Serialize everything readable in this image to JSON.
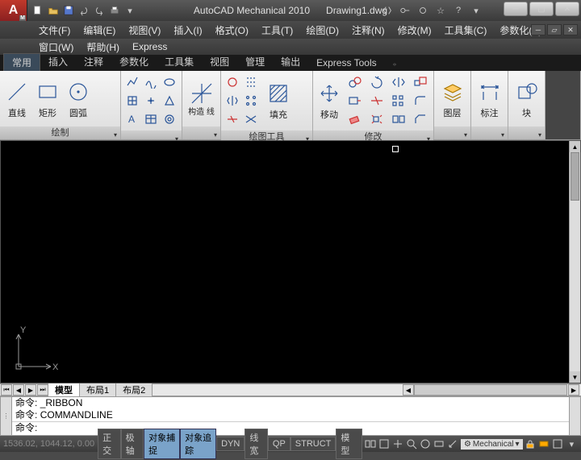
{
  "title": {
    "app": "AutoCAD Mechanical 2010",
    "doc": "Drawing1.dwg"
  },
  "menus1": [
    {
      "id": "file",
      "label": "文件(F)"
    },
    {
      "id": "edit",
      "label": "编辑(E)"
    },
    {
      "id": "view",
      "label": "视图(V)"
    },
    {
      "id": "insert",
      "label": "插入(I)"
    },
    {
      "id": "format",
      "label": "格式(O)"
    },
    {
      "id": "tools",
      "label": "工具(T)"
    },
    {
      "id": "draw",
      "label": "绘图(D)"
    },
    {
      "id": "annotate",
      "label": "注释(N)"
    },
    {
      "id": "modify",
      "label": "修改(M)"
    },
    {
      "id": "toolset",
      "label": "工具集(C)"
    },
    {
      "id": "param",
      "label": "参数化(P)"
    }
  ],
  "menus2": [
    {
      "id": "window",
      "label": "窗口(W)"
    },
    {
      "id": "help",
      "label": "帮助(H)"
    },
    {
      "id": "express",
      "label": "Express"
    }
  ],
  "ribbon_tabs": [
    {
      "id": "common",
      "label": "常用",
      "active": true
    },
    {
      "id": "insert",
      "label": "插入"
    },
    {
      "id": "annotate",
      "label": "注释"
    },
    {
      "id": "parametric",
      "label": "参数化"
    },
    {
      "id": "toolset",
      "label": "工具集"
    },
    {
      "id": "view",
      "label": "视图"
    },
    {
      "id": "manage",
      "label": "管理"
    },
    {
      "id": "output",
      "label": "输出"
    },
    {
      "id": "express",
      "label": "Express Tools"
    }
  ],
  "panels": {
    "draw": {
      "title": "绘制",
      "items": {
        "line": "直线",
        "rect": "矩形",
        "arc": "圆弧"
      }
    },
    "construct": {
      "title": "",
      "label": "构造\n线"
    },
    "drawtools": {
      "title": "绘图工具",
      "label": "填充"
    },
    "modify": {
      "title": "修改",
      "label": "移动"
    },
    "layers": {
      "title": "",
      "label": "图层"
    },
    "annotation": {
      "title": "",
      "label": "标注"
    },
    "block": {
      "title": "",
      "label": "块"
    }
  },
  "layout_tabs": [
    {
      "id": "model",
      "label": "模型",
      "active": true
    },
    {
      "id": "layout1",
      "label": "布局1"
    },
    {
      "id": "layout2",
      "label": "布局2"
    }
  ],
  "command": {
    "prefix": "命令:",
    "history": [
      "_RIBBON",
      "COMMANDLINE"
    ],
    "current": ""
  },
  "status": {
    "coords": "1536.02, 1044.12, 0.00",
    "toggles": [
      {
        "id": "ortho",
        "label": "正交",
        "on": false
      },
      {
        "id": "polar",
        "label": "极轴",
        "on": false
      },
      {
        "id": "osnap",
        "label": "对象捕捉",
        "on": true
      },
      {
        "id": "otrack",
        "label": "对象追踪",
        "on": true
      },
      {
        "id": "dyn",
        "label": "DYN",
        "on": false
      },
      {
        "id": "lwt",
        "label": "线宽",
        "on": false
      },
      {
        "id": "qp",
        "label": "QP",
        "on": false
      },
      {
        "id": "struct",
        "label": "STRUCT",
        "on": false
      }
    ],
    "model_btn": "模型",
    "workspace": "Mechanical"
  },
  "ucs": {
    "x": "X",
    "y": "Y"
  }
}
